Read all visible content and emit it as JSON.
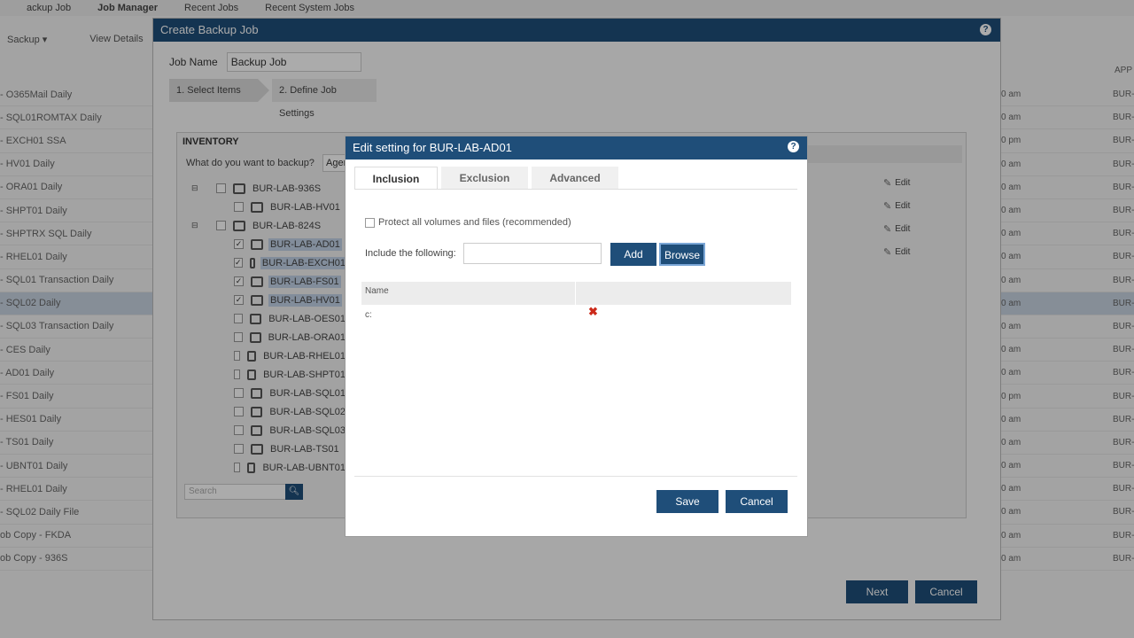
{
  "background": {
    "topnav": [
      "ackup Job",
      "Job Manager",
      "Recent Jobs",
      "Recent System Jobs"
    ],
    "toolbar": [
      "Sackup ▾",
      "View Details"
    ],
    "rows": [
      {
        "label": "- O365Mail Daily",
        "time": "0 am",
        "tag": "BUR-"
      },
      {
        "label": "- SQL01ROMTAX Daily",
        "time": "0 am",
        "tag": "BUR-"
      },
      {
        "label": "- EXCH01 SSA",
        "time": "0 pm",
        "tag": "BUR-"
      },
      {
        "label": "- HV01 Daily",
        "time": "0 am",
        "tag": "BUR-"
      },
      {
        "label": "- ORA01 Daily",
        "time": "0 am",
        "tag": "BUR-"
      },
      {
        "label": "- SHPT01 Daily",
        "time": "0 am",
        "tag": "BUR-"
      },
      {
        "label": "- SHPTRX SQL Daily",
        "time": "0 am",
        "tag": "BUR-"
      },
      {
        "label": "- RHEL01 Daily",
        "time": "0 am",
        "tag": "BUR-"
      },
      {
        "label": "- SQL01 Transaction Daily",
        "time": "0 am",
        "tag": "BUR-"
      },
      {
        "label": "- SQL02 Daily",
        "time": "0 am",
        "tag": "BUR-"
      },
      {
        "label": "- SQL03 Transaction Daily",
        "time": "0 am",
        "tag": "BUR-"
      },
      {
        "label": "- CES Daily",
        "time": "0 am",
        "tag": "BUR-"
      },
      {
        "label": "- AD01 Daily",
        "time": "0 am",
        "tag": "BUR-"
      },
      {
        "label": "- FS01 Daily",
        "time": "0 pm",
        "tag": "BUR-"
      },
      {
        "label": "- HES01 Daily",
        "time": "0 am",
        "tag": "BUR-"
      },
      {
        "label": "- TS01 Daily",
        "time": "0 am",
        "tag": "BUR-"
      },
      {
        "label": "- UBNT01 Daily",
        "time": "0 am",
        "tag": "BUR-"
      },
      {
        "label": "- RHEL01 Daily",
        "time": "0 am",
        "tag": "BUR-"
      },
      {
        "label": "- SQL02 Daily File",
        "time": "0 am",
        "tag": "BUR-"
      },
      {
        "label": "ob Copy - FKDA",
        "time": "0 am",
        "tag": "BUR-"
      },
      {
        "label": "ob Copy - 936S",
        "time": "0 am",
        "tag": "BUR-"
      }
    ],
    "right_header": "APP"
  },
  "create_job": {
    "title": "Create Backup Job",
    "job_name_label": "Job Name",
    "job_name_value": "Backup Job",
    "step1": "1. Select Items",
    "step2": "2. Define Job Settings",
    "inventory_title": "INVENTORY",
    "inventory_question": "What do you want to backup?",
    "inventory_select": "Agen",
    "tree": {
      "group1": "BUR-LAB-936S",
      "group1_child": "BUR-LAB-HV01",
      "group2": "BUR-LAB-824S",
      "children": [
        {
          "label": "BUR-LAB-AD01",
          "checked": true
        },
        {
          "label": "BUR-LAB-EXCH01",
          "checked": true
        },
        {
          "label": "BUR-LAB-FS01",
          "checked": true
        },
        {
          "label": "BUR-LAB-HV01",
          "checked": true
        },
        {
          "label": "BUR-LAB-OES01",
          "checked": false
        },
        {
          "label": "BUR-LAB-ORA01",
          "checked": false
        },
        {
          "label": "BUR-LAB-RHEL01",
          "checked": false
        },
        {
          "label": "BUR-LAB-SHPT01",
          "checked": false
        },
        {
          "label": "BUR-LAB-SQL01",
          "checked": false
        },
        {
          "label": "BUR-LAB-SQL02",
          "checked": false
        },
        {
          "label": "BUR-LAB-SQL03",
          "checked": false
        },
        {
          "label": "BUR-LAB-TS01",
          "checked": false
        },
        {
          "label": "BUR-LAB-UBNT01",
          "checked": false
        }
      ]
    },
    "search_placeholder": "Search",
    "edit_label": "Edit",
    "next": "Next",
    "cancel": "Cancel"
  },
  "edit_dialog": {
    "title": "Edit setting for BUR-LAB-AD01",
    "tabs": [
      "Inclusion",
      "Exclusion",
      "Advanced"
    ],
    "protect_label": "Protect all volumes and files (recommended)",
    "include_label": "Include the following:",
    "include_value": "",
    "add": "Add",
    "browse": "Browse",
    "grid_header": "Name",
    "grid_rows": [
      "c:"
    ],
    "save": "Save",
    "cancel": "Cancel"
  },
  "colors": {
    "title_bar": "#1f4e79",
    "button": "#1f4e79",
    "delete": "#cc2a1a"
  }
}
